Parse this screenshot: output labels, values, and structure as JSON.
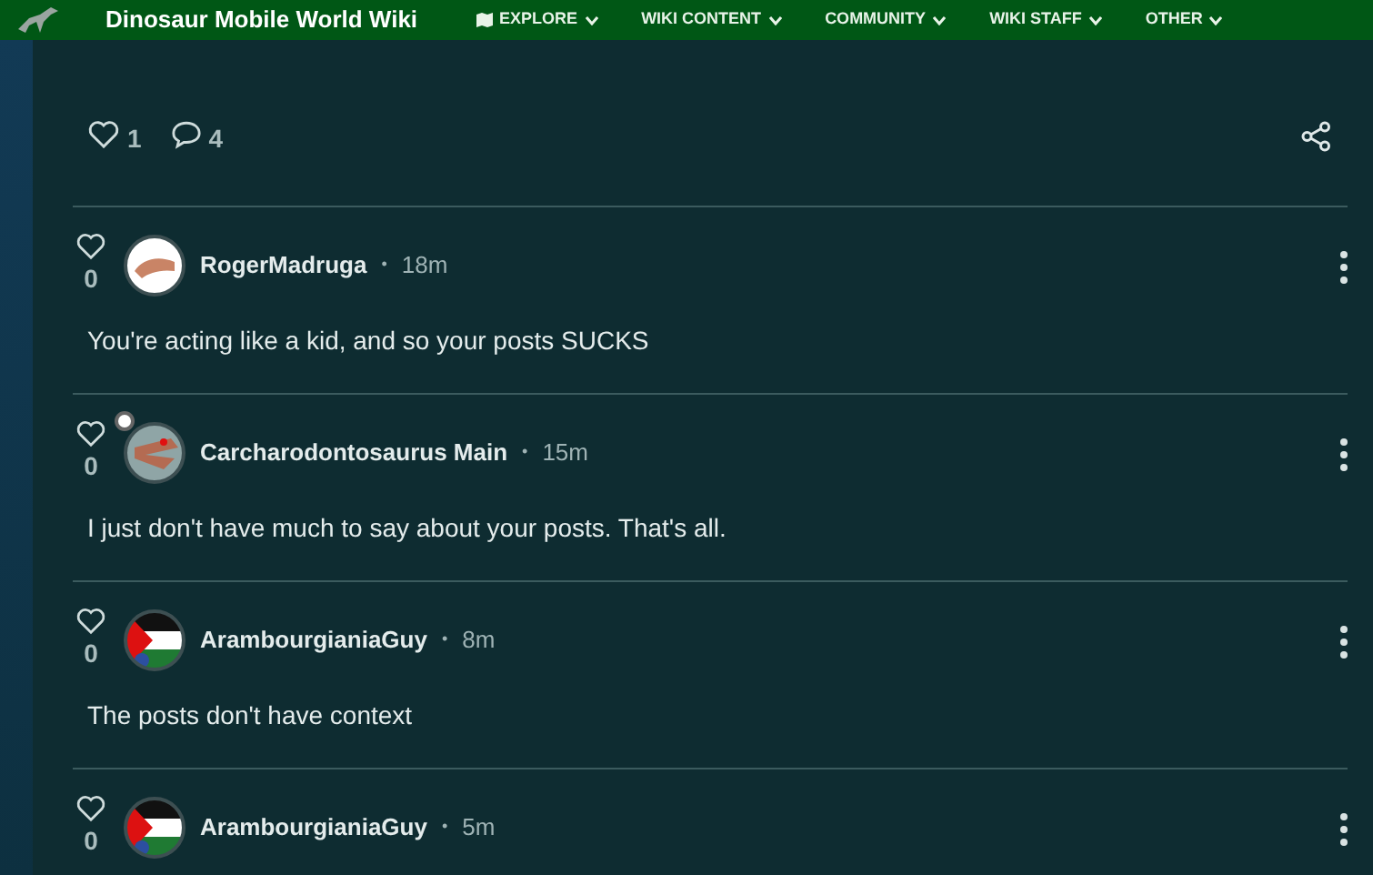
{
  "top_bar": {
    "site_title": "Dinosaur Mobile World Wiki",
    "nav": [
      {
        "label": "EXPLORE",
        "icon": true
      },
      {
        "label": "WIKI CONTENT",
        "icon": false
      },
      {
        "label": "COMMUNITY",
        "icon": false
      },
      {
        "label": "WIKI STAFF",
        "icon": false
      },
      {
        "label": "OTHER",
        "icon": false
      }
    ]
  },
  "post_stats": {
    "likes": "1",
    "comments": "4"
  },
  "comments": [
    {
      "likes": "0",
      "author": "RogerMadruga",
      "separator": "•",
      "time": "18m",
      "text": "You're acting like a kid, and so your posts SUCKS",
      "kind": "hand",
      "badge": false
    },
    {
      "likes": "0",
      "author": "Carcharodontosaurus Main",
      "separator": "•",
      "time": "15m",
      "text": "I just don't have much to say about your posts. That's all.",
      "kind": "dino",
      "badge": true
    },
    {
      "likes": "0",
      "author": "ArambourgianiaGuy",
      "separator": "•",
      "time": "8m",
      "text": "The posts don't have context",
      "kind": "flag",
      "badge": false
    },
    {
      "likes": "0",
      "author": "ArambourgianiaGuy",
      "separator": "•",
      "time": "5m",
      "kind": "flag",
      "badge": false
    }
  ]
}
